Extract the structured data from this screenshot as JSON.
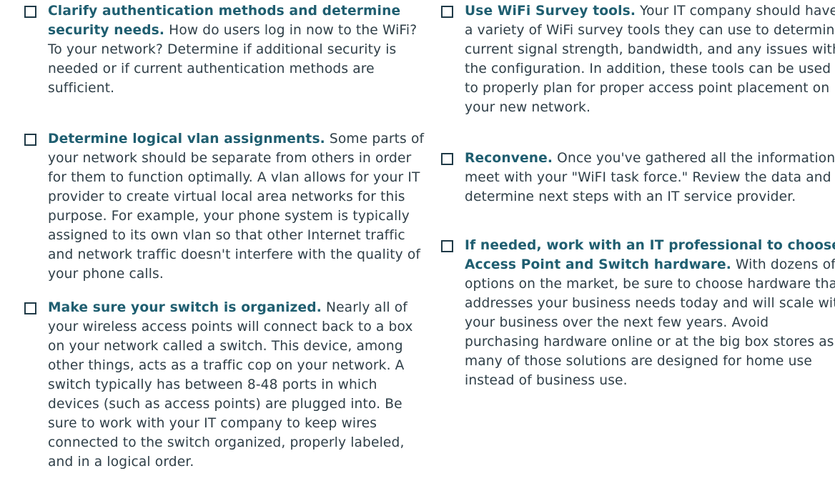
{
  "left_column": [
    {
      "title": "Clarify authentication methods and determine security needs.",
      "body": " How do users log in now to the WiFi? To your network? Determine if additional security is needed or if current authentication methods are sufficient."
    },
    {
      "title": "Determine logical vlan assignments.",
      "body": " Some parts of your network should be separate from others in order for them to function optimally. A vlan allows for your IT provider to create virtual local area networks for this purpose. For example, your phone system is typically assigned to its own vlan so that other Internet traffic and network traffic doesn't interfere with the quality of your phone calls."
    },
    {
      "title": "Make sure your switch is organized.",
      "body": " Nearly all of your wireless access points will connect back to a box on your network called a switch. This device, among other things, acts as a traffic cop on your network. A switch typically has between 8-48 ports in which devices (such as access points) are plugged into. Be sure to work with your IT company to keep wires connected to the switch organized, properly labeled, and in a logical order."
    }
  ],
  "right_column": [
    {
      "title": "Use WiFi Survey tools.",
      "body": " Your IT company should have a variety of WiFi survey tools they can use to determine current signal strength, bandwidth, and any issues with the configuration. In addition, these tools can be used to properly plan for proper access point placement on your new network."
    },
    {
      "title": "Reconvene.",
      "body": " Once you've gathered all the information, meet with your \"WiFI task force.\" Review the data and determine next steps with an IT service provider."
    },
    {
      "title": "If needed, work with an IT professional to choose Access Point and Switch hardware.",
      "body": " With dozens of options on the market, be sure to choose hardware that addresses your business needs today and will scale with your business over the next few years. Avoid purchasing hardware online or at the big box stores as many of those solutions are designed for home use instead of business use."
    }
  ]
}
